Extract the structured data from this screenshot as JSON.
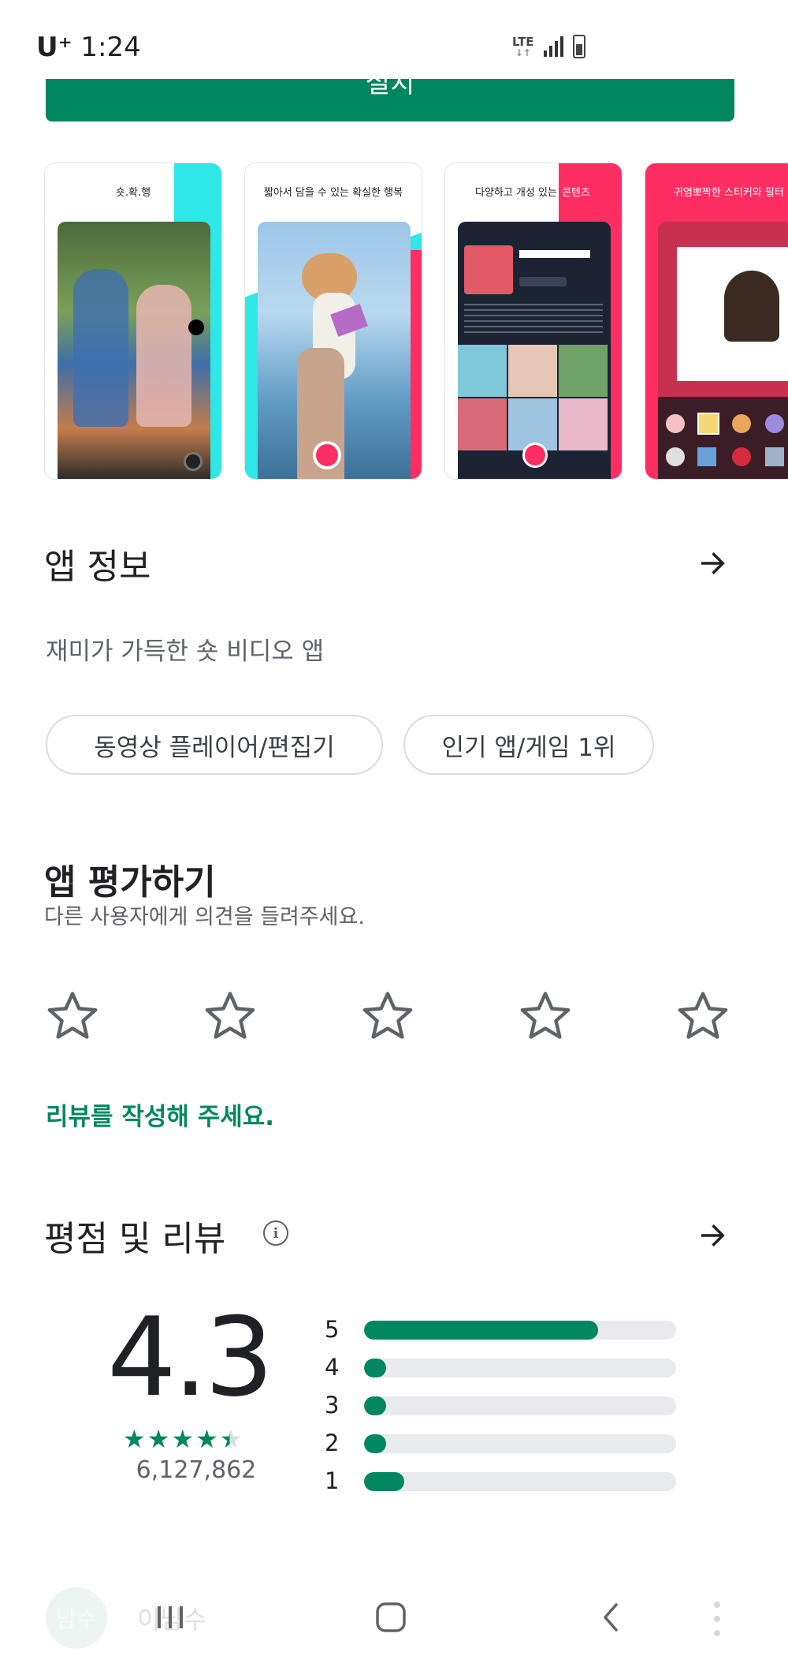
{
  "status_bar": {
    "carrier": "U⁺",
    "time": "1:24",
    "network": "LTE"
  },
  "install_button": {
    "label": "설치"
  },
  "screenshots": [
    {
      "caption": "숏.확.행"
    },
    {
      "caption": "짧아서 담을 수 있는 확실한 행복"
    },
    {
      "caption_prefix": "다양하고 개성 있는 ",
      "caption_highlight": "콘텐츠"
    },
    {
      "caption": "귀염뽀짝한 스티커와 필터"
    }
  ],
  "about": {
    "title": "앱 정보",
    "description": "재미가 가득한 숏 비디오 앱",
    "tags": [
      "동영상 플레이어/편집기",
      "인기 앱/게임 1위"
    ]
  },
  "rate_app": {
    "title": "앱 평가하기",
    "subtitle": "다른 사용자에게 의견을 들려주세요.",
    "star_count": 5,
    "write_review": "리뷰를 작성해 주세요."
  },
  "ratings": {
    "title": "평점 및 리뷰",
    "score": "4.3",
    "score_stars": 4.3,
    "review_count": "6,127,862",
    "histogram": [
      {
        "label": "5",
        "fraction": 0.75
      },
      {
        "label": "4",
        "fraction": 0.07
      },
      {
        "label": "3",
        "fraction": 0.06
      },
      {
        "label": "2",
        "fraction": 0.06
      },
      {
        "label": "1",
        "fraction": 0.13
      }
    ]
  },
  "partial_review": {
    "avatar_text": "남수",
    "reviewer_name": "이남수"
  },
  "colors": {
    "accent": "#01875f",
    "track": "#e8eaed",
    "tiktok_cyan": "#2ee7e6",
    "tiktok_pink": "#ff2e62"
  },
  "icons": {
    "about_arrow": "arrow-right-icon",
    "ratings_arrow": "arrow-right-icon",
    "info": "info-icon",
    "star": "star-outline-icon",
    "nav_recents": "recents-icon",
    "nav_home": "home-icon",
    "nav_back": "back-icon"
  }
}
